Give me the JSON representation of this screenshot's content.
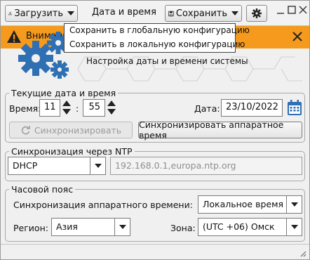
{
  "toolbar": {
    "upload_label": "Загрузить",
    "window_title": "Дата и время",
    "save_label": "Сохранить"
  },
  "save_menu": {
    "items": [
      "Сохранить в глобальную конфигурацию",
      "Сохранить в локальную конфигурацию"
    ]
  },
  "warning": {
    "label": "Внимание"
  },
  "header": {
    "title": "Настройка даты и времени системы"
  },
  "current_datetime": {
    "legend": "Текущие дата и время",
    "time_label": "Время:",
    "hours": "11",
    "separator": ":",
    "minutes": "55",
    "date_label": "Дата:",
    "date": "23/10/2022",
    "sync_button": "Синхронизировать",
    "sync_hw_button": "Синхронизировать аппаратное время"
  },
  "ntp": {
    "legend": "Синхронизация через NTP",
    "mode": "DHCP",
    "servers": "192.168.0.1,europa.ntp.org"
  },
  "timezone": {
    "legend": "Часовой пояс",
    "hw_sync_label": "Синхронизация аппаратного времени:",
    "hw_sync_value": "Локальное время",
    "region_label": "Регион:",
    "region_value": "Азия",
    "zone_label": "Зона:",
    "zone_value": "(UTC +06) Омск"
  },
  "colors": {
    "warning_bar": "#f59a1d",
    "gear_blue": "#2f6fb3"
  }
}
